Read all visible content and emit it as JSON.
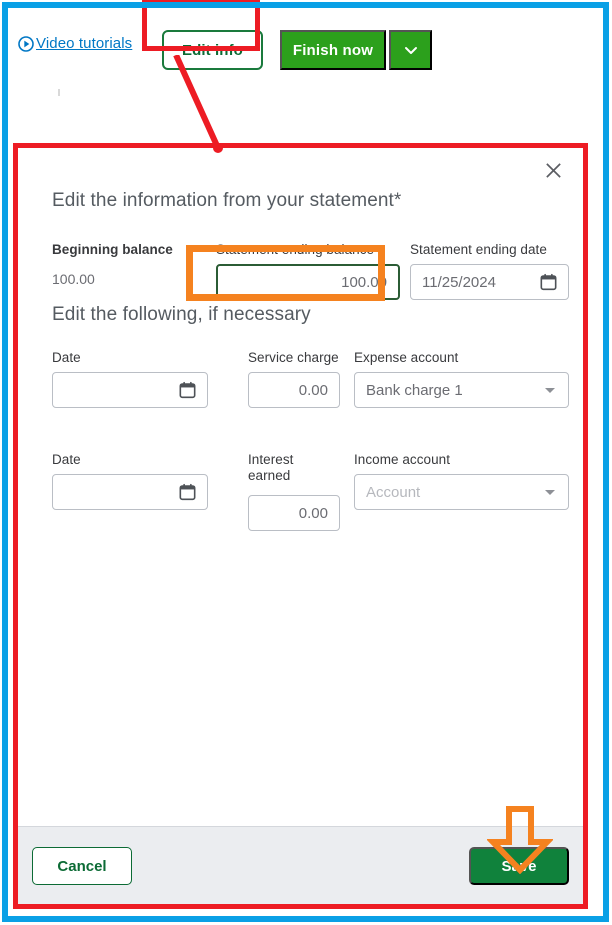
{
  "toolbar": {
    "video_tutorials_label": "Video tutorials",
    "video_icon": "play-circle-icon",
    "edit_info_label": "Edit info",
    "finish_now_label": "Finish now",
    "finish_caret_icon": "chevron-down-icon"
  },
  "dialog": {
    "close_icon": "close-icon",
    "heading": "Edit the information from your statement*",
    "statement": {
      "beginning_balance_label": "Beginning balance",
      "beginning_balance_value": "100.00",
      "ending_balance_label": "Statement ending balance",
      "ending_balance_value": "100.00",
      "ending_date_label": "Statement ending date",
      "ending_date_value": "11/25/2024",
      "ending_date_icon": "calendar-icon"
    },
    "optional_heading": "Edit the following, if necessary",
    "service_charge": {
      "date_label": "Date",
      "date_value": "",
      "date_icon": "calendar-icon",
      "amount_label": "Service charge",
      "amount_value": "0.00",
      "account_label": "Expense account",
      "account_value": "Bank charge 1",
      "account_caret_icon": "chevron-down-icon"
    },
    "interest_earned": {
      "date_label": "Date",
      "date_value": "",
      "date_icon": "calendar-icon",
      "amount_label": "Interest earned",
      "amount_value": "0.00",
      "account_label": "Income account",
      "account_placeholder": "Account",
      "account_caret_icon": "chevron-down-icon"
    },
    "footer": {
      "cancel_label": "Cancel",
      "save_label": "Save"
    }
  },
  "annotations": {
    "outer_frame_color": "#0aa0e6",
    "highlight_box_color": "#ed1c24",
    "focus_highlight_color": "#f5821f",
    "callout_line_color": "#ed1c24",
    "arrow_color": "#f5821f",
    "brand_green": "#2ca01c",
    "link_blue": "#0077c5"
  }
}
